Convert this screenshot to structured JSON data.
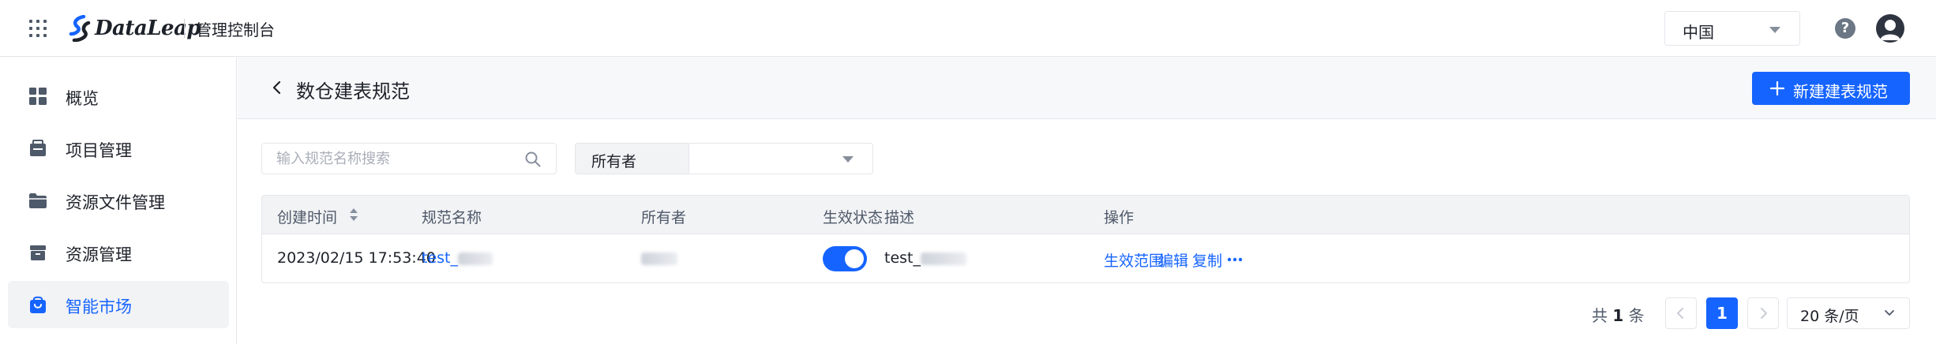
{
  "header": {
    "brand": "DataLeap",
    "console_title": "管理控制台",
    "region": "中国",
    "help": "?"
  },
  "sidebar": {
    "items": [
      {
        "label": "概览",
        "icon": "dashboard-icon"
      },
      {
        "label": "项目管理",
        "icon": "project-icon"
      },
      {
        "label": "资源文件管理",
        "icon": "folder-icon"
      },
      {
        "label": "资源管理",
        "icon": "box-icon"
      },
      {
        "label": "智能市场",
        "icon": "bag-icon",
        "active": true
      }
    ]
  },
  "page": {
    "title": "数仓建表规范",
    "new_button": "新建建表规范"
  },
  "filters": {
    "search_placeholder": "输入规范名称搜索",
    "owner_label": "所有者",
    "owner_value": ""
  },
  "table": {
    "columns": [
      "创建时间",
      "规范名称",
      "所有者",
      "生效状态",
      "描述",
      "操作"
    ],
    "rows": [
      {
        "created": "2023/02/15 17:53:40",
        "name": "test_",
        "owner": "",
        "enabled": true,
        "description": "test_",
        "actions": [
          "生效范围",
          "编辑",
          "复制"
        ]
      }
    ]
  },
  "pagination": {
    "total_prefix": "共",
    "total": "1",
    "total_suffix": "条",
    "current_page": "1",
    "page_size": "20 条/页"
  },
  "colors": {
    "accent": "#1664ff",
    "text": "#1d2129",
    "muted": "#4e5969"
  }
}
